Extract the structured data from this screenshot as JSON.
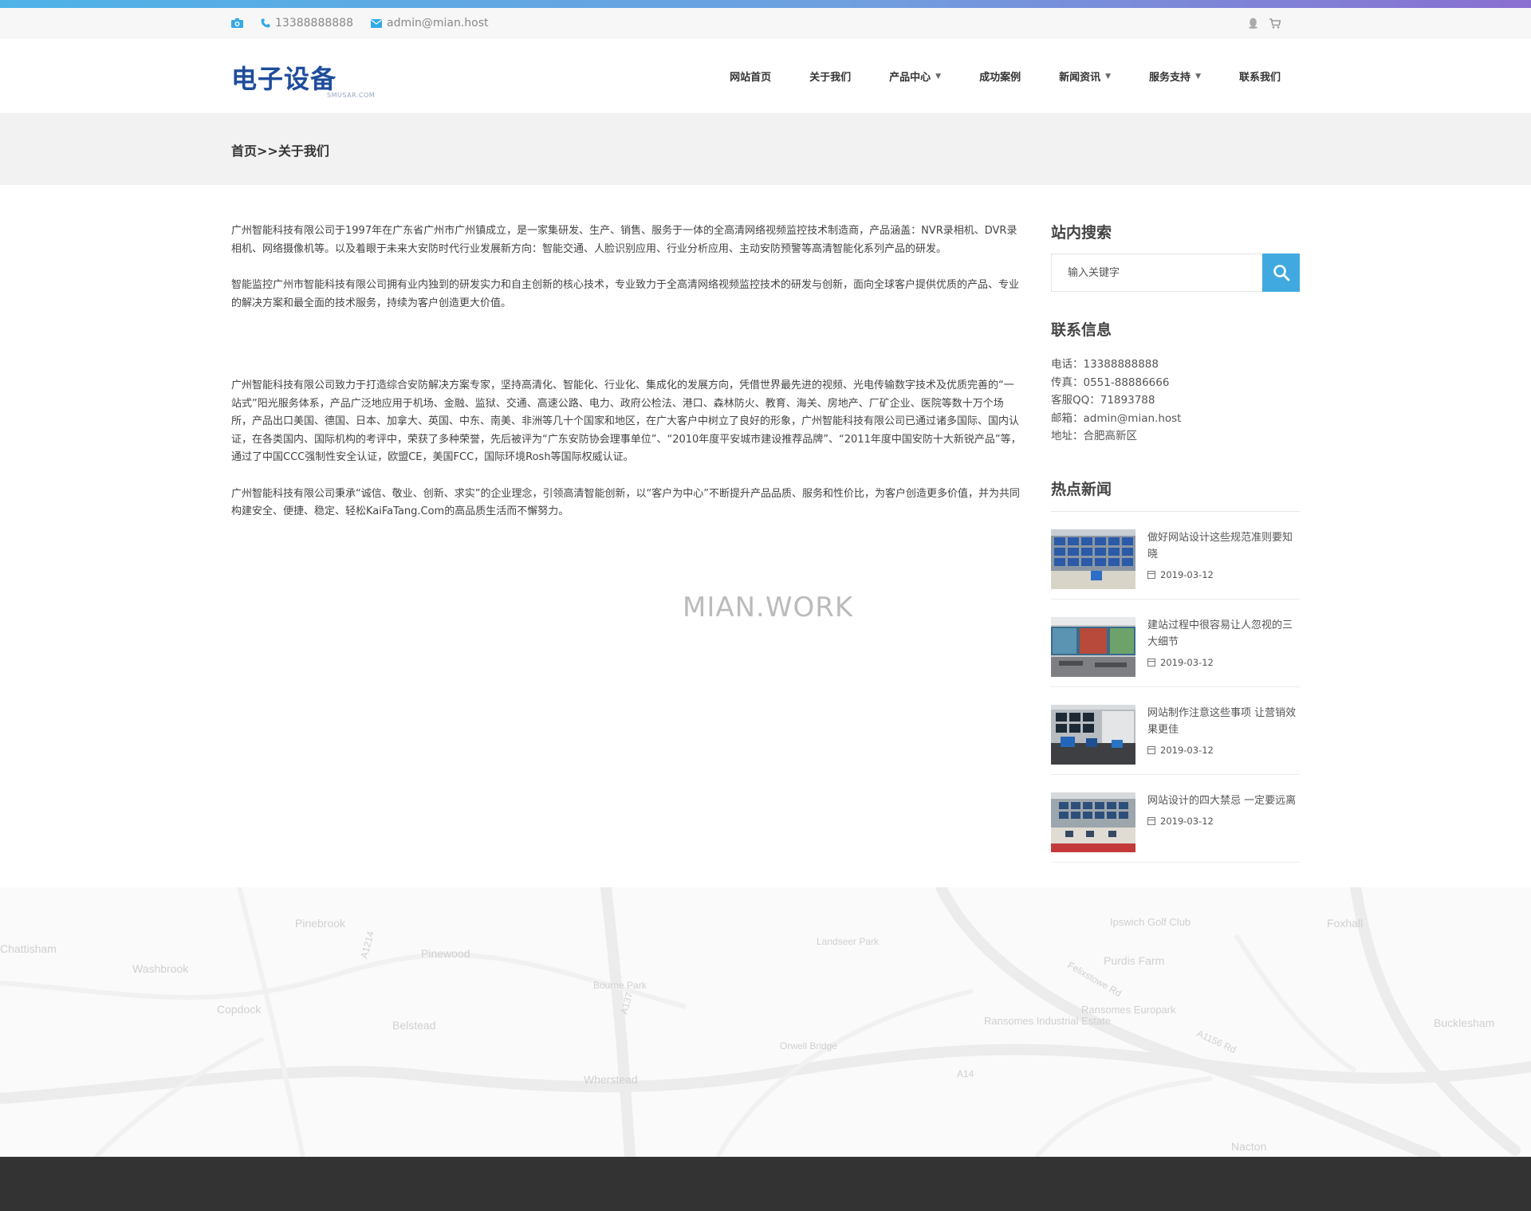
{
  "topbar": {
    "phone": "13388888888",
    "email": "admin@mian.host"
  },
  "logo": {
    "main": "电子设备",
    "sub": "SMUSAR.COM"
  },
  "nav": [
    {
      "label": "网站首页",
      "dropdown": false
    },
    {
      "label": "关于我们",
      "dropdown": false
    },
    {
      "label": "产品中心",
      "dropdown": true
    },
    {
      "label": "成功案例",
      "dropdown": false
    },
    {
      "label": "新闻资讯",
      "dropdown": true
    },
    {
      "label": "服务支持",
      "dropdown": true
    },
    {
      "label": "联系我们",
      "dropdown": false
    }
  ],
  "breadcrumb": "首页>>关于我们",
  "content": {
    "p1": "广州智能科技有限公司于1997年在广东省广州市广州镇成立，是一家集研发、生产、销售、服务于一体的全高清网络视频监控技术制造商，产品涵盖：NVR录相机、DVR录相机、网络摄像机等。以及着眼于未来大安防时代行业发展新方向：智能交通、人脸识别应用、行业分析应用、主动安防预警等高清智能化系列产品的研发。",
    "p2": "智能监控广州市智能科技有限公司拥有业内独到的研发实力和自主创新的核心技术，专业致力于全高清网络视频监控技术的研发与创新，面向全球客户提供优质的产品、专业的解决方案和最全面的技术服务，持续为客户创造更大价值。",
    "p3": "广州智能科技有限公司致力于打造综合安防解决方案专家，坚持高清化、智能化、行业化、集成化的发展方向，凭借世界最先进的视频、光电传输数字技术及优质完善的“一站式”阳光服务体系，产品广泛地应用于机场、金融、监狱、交通、高速公路、电力、政府公检法、港口、森林防火、教育、海关、房地产、厂矿企业、医院等数十万个场所，产品出口美国、德国、日本、加拿大、英国、中东、南美、非洲等几十个国家和地区，在广大客户中树立了良好的形象，广州智能科技有限公司已通过诸多国际、国内认证，在各类国内、国际机构的考评中，荣获了多种荣誉，先后被评为“广东安防协会理事单位”、“2010年度平安城市建设推荐品牌”、“2011年度中国安防十大新锐产品”等，通过了中国CCC强制性安全认证，欧盟CE，美国FCC，国际环境Rosh等国际权威认证。",
    "p4": "广州智能科技有限公司秉承“诚信、敬业、创新、求实”的企业理念，引领高清智能创新，以“客户为中心”不断提升产品品质、服务和性价比，为客户创造更多价值，并为共同构建安全、便捷、稳定、轻松KaiFaTang.Com的高品质生活而不懈努力。"
  },
  "watermark": "MIAN.WORK",
  "sidebar": {
    "search_title": "站内搜索",
    "search_placeholder": "输入关键字",
    "contact_title": "联系信息",
    "contact": [
      "电话：13388888888",
      "传真：0551-88886666",
      "客服QQ：71893788",
      "邮箱：admin@mian.host",
      "地址：合肥高新区"
    ],
    "hot_title": "热点新闻",
    "news": [
      {
        "title": "做好网站设计这些规范准则要知晓",
        "date": "2019-03-12"
      },
      {
        "title": "建站过程中很容易让人忽视的三大细节",
        "date": "2019-03-12"
      },
      {
        "title": "网站制作注意这些事项 让营销效果更佳",
        "date": "2019-03-12"
      },
      {
        "title": "网站设计的四大禁忌 一定要远离",
        "date": "2019-03-12"
      }
    ]
  },
  "map_labels": [
    "Pinebrook",
    "Pinewood",
    "Chattisham",
    "Washbrook",
    "Copdock",
    "Belstead",
    "Bourne Park",
    "Wherstead",
    "Landseer Park",
    "Ipswich Golf Club",
    "Purdis Farm",
    "Foxhall",
    "Ransomes Industrial Estate",
    "Ransomes Europark",
    "Orwell Bridge",
    "Bucklesham",
    "Nacton",
    "A14",
    "A137",
    "A1214",
    "A1156 Rd",
    "Felixstowe Rd"
  ],
  "colors": {
    "accent": "#3fa9e0",
    "logo": "#1f4d9c",
    "footer": "#333333"
  }
}
